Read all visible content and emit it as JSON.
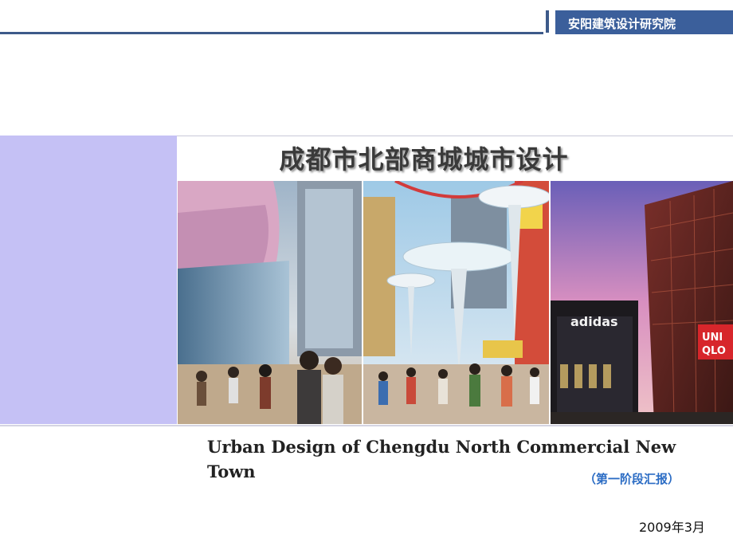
{
  "header": {
    "organization": "安阳建筑设计研究院"
  },
  "title": {
    "main": "成都市北部商城城市设计",
    "english": "Urban Design of Chengdu North Commercial New Town",
    "stage": "（第一阶段汇报）",
    "date": "2009年3月"
  },
  "photos": {
    "photo_3_signs": [
      "adidas",
      "UNI",
      "QLO"
    ]
  },
  "colors": {
    "accent_blue": "#3b5f9b",
    "lavender": "#c5c1f5",
    "stage_blue": "#2b6cc4"
  }
}
